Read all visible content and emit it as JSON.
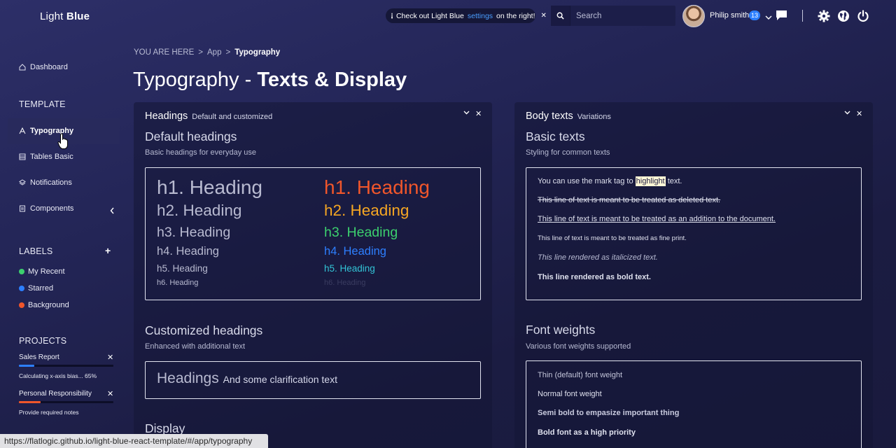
{
  "header": {
    "logo_light": "Light",
    "logo_bold": "Blue",
    "notice_pre": "Check out Light Blue",
    "notice_link": "settings",
    "notice_post": "on the right!",
    "search_placeholder": "Search",
    "user_name": "Philip smith",
    "notification_count": "13"
  },
  "sidebar": {
    "dashboard": "Dashboard",
    "template_heading": "TEMPLATE",
    "typography": "Typography",
    "tables": "Tables Basic",
    "notifications": "Notifications",
    "components": "Components",
    "labels_heading": "LABELS",
    "labels": [
      {
        "label": "My Recent",
        "color": "#3ccf6e"
      },
      {
        "label": "Starred",
        "color": "#2d7fff"
      },
      {
        "label": "Background",
        "color": "#f0562b"
      }
    ],
    "projects_heading": "PROJECTS",
    "projects": [
      {
        "title": "Sales Report",
        "note": "Calculating x-axis bias... 65%",
        "progress": 0.16,
        "color": "#2d7fff"
      },
      {
        "title": "Personal Responsibility",
        "note": "Provide required notes",
        "progress": 0.23,
        "color": "#f0562b"
      }
    ]
  },
  "breadcrumb": {
    "root": "YOU ARE HERE",
    "sep": ">",
    "app": "App",
    "current": "Typography"
  },
  "page_title": {
    "light": "Typography -",
    "bold": "Texts & Display"
  },
  "headings_card": {
    "title": "Headings",
    "subtitle": "Default and customized",
    "default_title": "Default headings",
    "default_sub": "Basic headings for everyday use",
    "h1": "h1. Heading",
    "h2": "h2. Heading",
    "h3": "h3. Heading",
    "h4": "h4. Heading",
    "h5": "h5. Heading",
    "h6": "h6. Heading",
    "custom_title": "Customized headings",
    "custom_sub": "Enhanced with additional text",
    "custom_main": "Headings",
    "custom_small": "And some clarification text",
    "display_title": "Display",
    "colors": {
      "h1": "#f0562b",
      "h2": "#f5a623",
      "h3": "#3ccf6e",
      "h4": "#2d7fff",
      "h5": "#32c4d6",
      "h6": "#3a3c60"
    }
  },
  "body_card": {
    "title": "Body texts",
    "subtitle": "Variations",
    "basic_title": "Basic texts",
    "basic_sub": "Styling for common texts",
    "mark_pre": "You can use the mark tag to",
    "mark_word": "highlight",
    "mark_post": "text.",
    "deleted": "This line of text is meant to be treated as deleted text.",
    "added": "This line of text is meant to be treated as an addition to the document.",
    "fine": "This line of text is meant to be treated as fine print.",
    "italic": "This line rendered as italicized text.",
    "bold": "This line rendered as bold text.",
    "weights_title": "Font weights",
    "weights_sub": "Various font weights supported",
    "w_thin": "Thin (default) font weight",
    "w_normal": "Normal font weight",
    "w_semibold": "Semi bold to empasize important thing",
    "w_bold": "Bold font as a high priority"
  },
  "status_url": "https://flatlogic.github.io/light-blue-react-template/#/app/typography"
}
